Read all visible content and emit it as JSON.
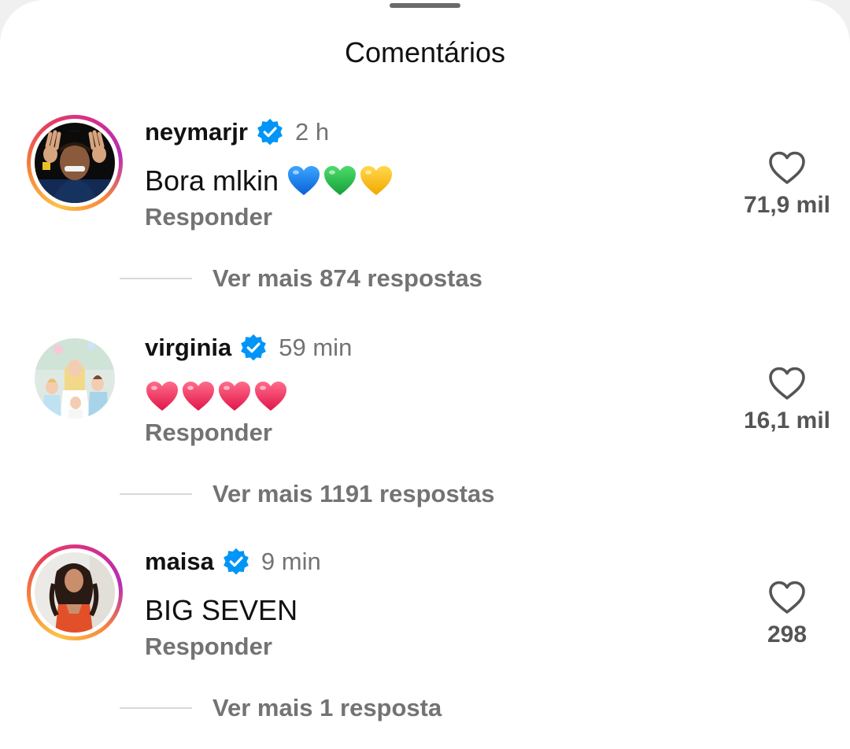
{
  "sheet": {
    "title": "Comentários"
  },
  "comments": [
    {
      "username": "neymarjr",
      "verified": true,
      "time": "2 h",
      "text": "Bora mlkin",
      "emoji": [
        "blue-heart",
        "green-heart",
        "yellow-heart"
      ],
      "reply_label": "Responder",
      "likes": "71,9 mil",
      "more_replies": "Ver mais 874 respostas",
      "has_story_ring": true
    },
    {
      "username": "virginia",
      "verified": true,
      "time": "59 min",
      "text": "",
      "emoji": [
        "red-heart",
        "red-heart",
        "red-heart",
        "red-heart"
      ],
      "reply_label": "Responder",
      "likes": "16,1 mil",
      "more_replies": "Ver mais 1191 respostas",
      "has_story_ring": false
    },
    {
      "username": "maisa",
      "verified": true,
      "time": "9 min",
      "text": "BIG SEVEN",
      "emoji": [],
      "reply_label": "Responder",
      "likes": "298",
      "more_replies": "Ver mais 1 resposta",
      "has_story_ring": true
    }
  ],
  "colors": {
    "verified_blue": "#0095f6",
    "secondary_text": "#737373",
    "primary_text": "#111111"
  }
}
